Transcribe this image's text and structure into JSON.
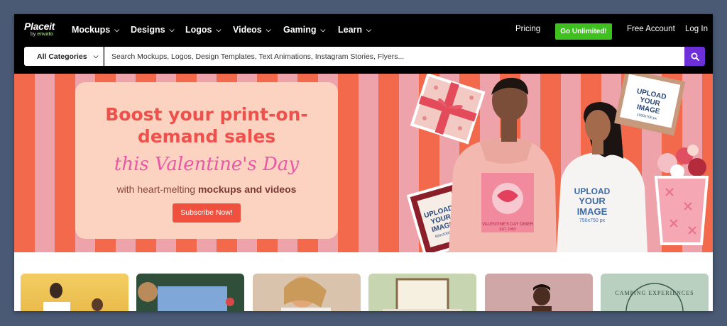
{
  "logo": {
    "primary": "Placeit",
    "byline_prefix": "by",
    "byline_brand": "envato"
  },
  "nav": {
    "items": [
      {
        "label": "Mockups"
      },
      {
        "label": "Designs"
      },
      {
        "label": "Logos"
      },
      {
        "label": "Videos"
      },
      {
        "label": "Gaming"
      },
      {
        "label": "Learn"
      }
    ],
    "pricing": "Pricing",
    "go_unlimited": "Go Unlimited!",
    "free_account": "Free Account",
    "login": "Log In"
  },
  "search": {
    "category": "All Categories",
    "placeholder": "Search Mockups, Logos, Design Templates, Text Animations, Instagram Stories, Flyers..."
  },
  "hero": {
    "title_line1": "Boost your print-on-",
    "title_line2": "demand sales",
    "script": "this Valentine's Day",
    "sub_prefix": "with heart-melting ",
    "sub_bold": "mockups and videos",
    "cta": "Subscribe Now!",
    "upload_labels": [
      {
        "l1": "UPLOAD",
        "l2": "YOUR",
        "l3": "IMAGE",
        "size": "1000x700 px"
      },
      {
        "l1": "UPLOAD",
        "l2": "YOUR",
        "l3": "IMAGE",
        "size": "800x1000 px"
      },
      {
        "l1": "UPLOAD",
        "l2": "YOUR",
        "l3": "IMAGE",
        "size": "750x750 px"
      }
    ],
    "hoodie_caption": "VALENTINE'S DAY DINER",
    "hoodie_est": "EST. 1983",
    "card_text": "CAMPING EXPERIENCES"
  },
  "colors": {
    "stripe_orange": "#f26a4b",
    "stripe_pink": "#eea3aa",
    "promo_bg": "#fbd3c0",
    "title": "#f0504b",
    "script": "#e957a8",
    "cta": "#f0513f",
    "go_unlimited": "#3ec11e",
    "search_button": "#6d2fd8"
  }
}
